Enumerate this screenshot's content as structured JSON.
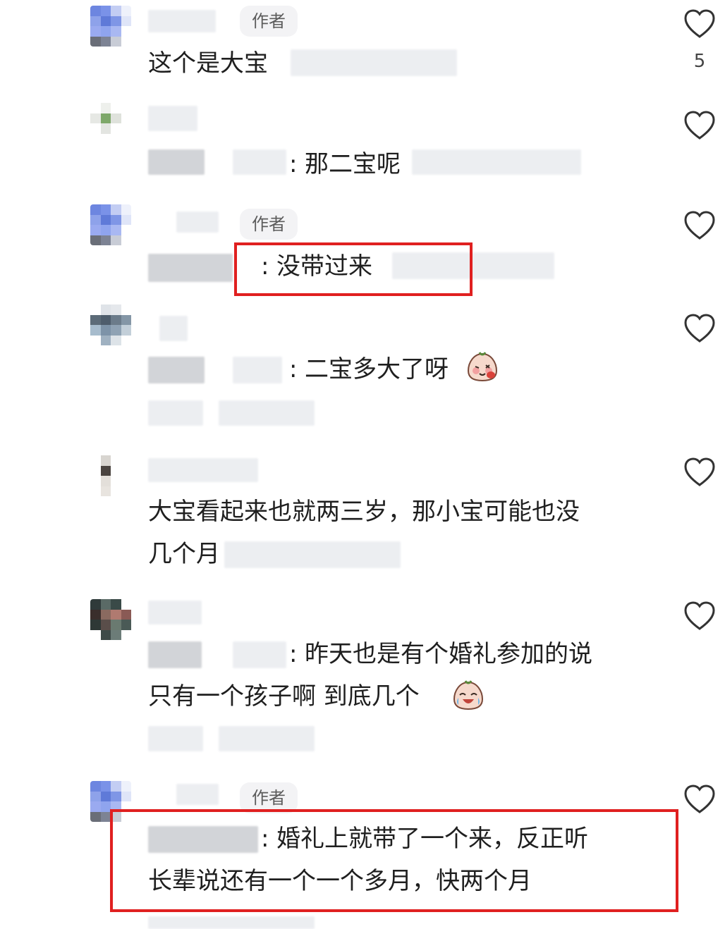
{
  "author_label": "作者",
  "comments": [
    {
      "text": "这个是大宝",
      "likes": "5"
    },
    {
      "reply_text": "那二宝呢"
    },
    {
      "reply_text": "没带过来"
    },
    {
      "reply_text": "二宝多大了呀",
      "emoji": "face-with-tongue-emoji"
    },
    {
      "line1": "大宝看起来也就两三岁，那小宝可能也没",
      "line2": "几个月"
    },
    {
      "line1": "昨天也是有个婚礼参加的说",
      "line2": "只有一个孩子啊 到底几个",
      "emoji": "laughing-tears-emoji"
    },
    {
      "line1": "婚礼上就带了一个来，反正听",
      "line2": "长辈说还有一个一个多月，快两个月"
    }
  ],
  "colon": ":",
  "colors": {
    "highlight": "#e02020",
    "text": "#1f1f1f",
    "badge_bg": "#f3f3f5"
  }
}
